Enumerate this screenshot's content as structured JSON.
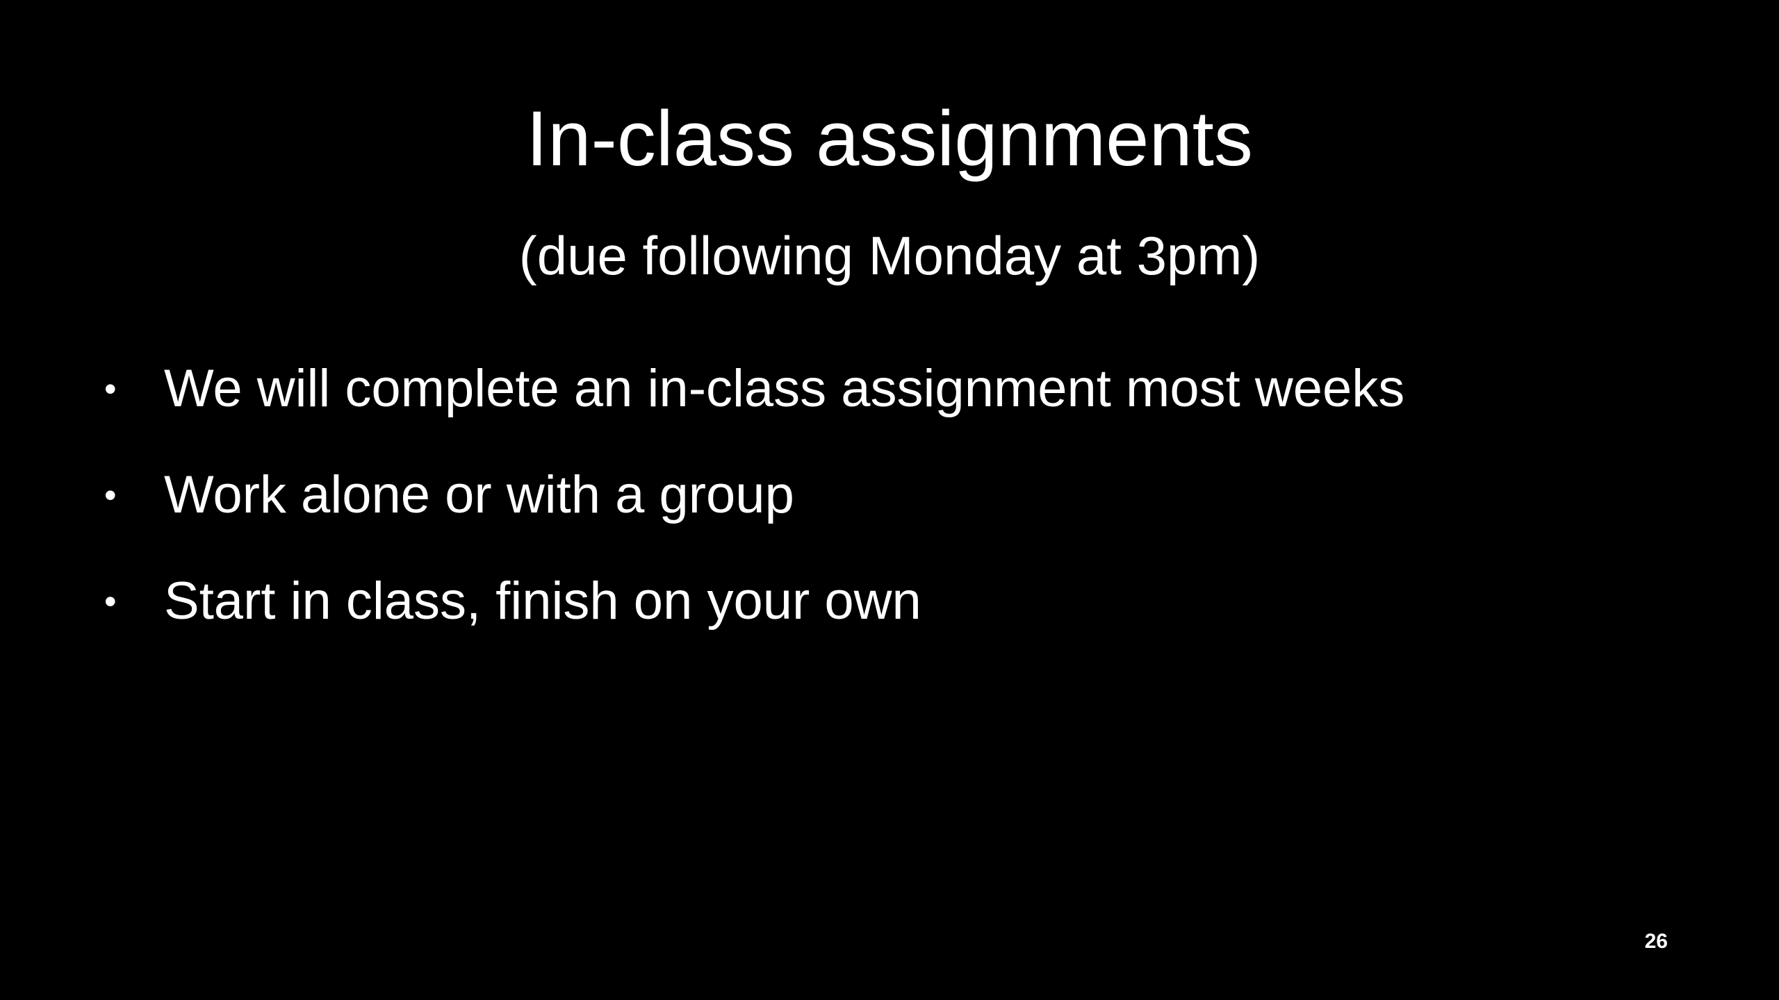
{
  "slide": {
    "title": "In-class assignments",
    "subtitle": "(due following Monday at 3pm)",
    "bullets": [
      "We will complete an in-class assignment most weeks",
      "Work alone or with a group",
      "Start in class, finish on your own"
    ],
    "bullet_glyph": "•",
    "page_number": "26"
  }
}
